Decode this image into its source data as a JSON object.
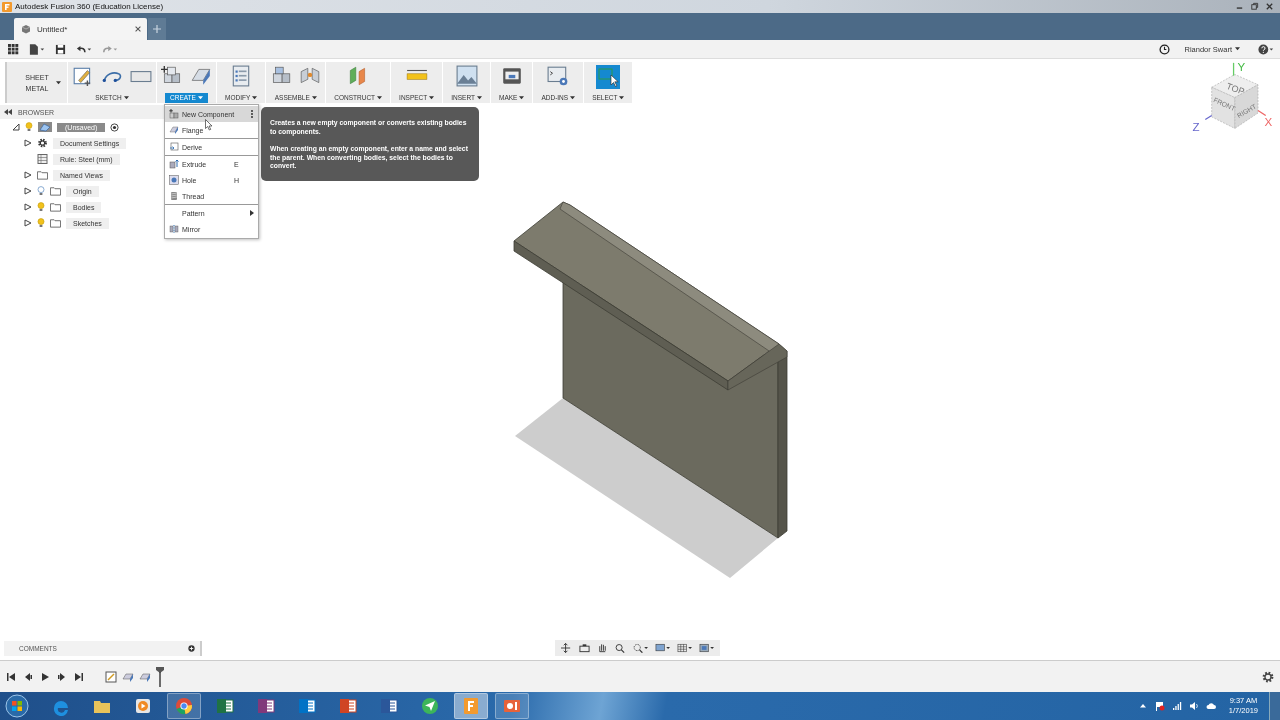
{
  "title_bar": {
    "title": "Autodesk Fusion 360 (Education License)"
  },
  "document_tabs": [
    {
      "label": "Untitled*",
      "selected": true
    }
  ],
  "user": {
    "name": "Riandor Swart"
  },
  "ribbon": {
    "workspace": "SHEET METAL",
    "groups": [
      {
        "label": "SKETCH",
        "selected": false
      },
      {
        "label": "CREATE",
        "selected": true
      },
      {
        "label": "MODIFY",
        "selected": false
      },
      {
        "label": "ASSEMBLE",
        "selected": false
      },
      {
        "label": "CONSTRUCT",
        "selected": false
      },
      {
        "label": "INSPECT",
        "selected": false
      },
      {
        "label": "INSERT",
        "selected": false
      },
      {
        "label": "MAKE",
        "selected": false
      },
      {
        "label": "ADD-INS",
        "selected": false
      },
      {
        "label": "SELECT",
        "selected": false
      }
    ]
  },
  "create_menu": {
    "items": [
      {
        "kind": "command",
        "label": "New Component",
        "selected": true,
        "divider_after": false
      },
      {
        "kind": "command",
        "label": "Flange",
        "selected": false,
        "divider_after": true
      },
      {
        "kind": "command",
        "label": "Derive",
        "selected": false,
        "divider_after": true
      },
      {
        "kind": "command",
        "label": "Extrude",
        "shortcut": "E",
        "selected": false,
        "divider_after": false
      },
      {
        "kind": "command",
        "label": "Hole",
        "shortcut": "H",
        "selected": false,
        "divider_after": false
      },
      {
        "kind": "command",
        "label": "Thread",
        "selected": false,
        "divider_after": true
      },
      {
        "kind": "submenu",
        "label": "Pattern",
        "selected": false,
        "divider_after": false
      },
      {
        "kind": "command",
        "label": "Mirror",
        "selected": false,
        "divider_after": false
      }
    ]
  },
  "tooltip": {
    "paragraphs": [
      "Creates a new empty component or converts existing bodies to components.",
      "When creating an empty component, enter a name and select the parent. When converting bodies, select the bodies to convert."
    ]
  },
  "browser": {
    "title": "BROWSER",
    "root": {
      "label": "(Unsaved)",
      "expanded": true,
      "visible": true,
      "children": [
        {
          "kind": "settings",
          "label": "Document Settings",
          "expanded": false
        },
        {
          "kind": "rule",
          "label": "Rule: Steel (mm)"
        },
        {
          "kind": "folder",
          "label": "Named Views",
          "expanded": false
        },
        {
          "kind": "folder",
          "label": "Origin",
          "expanded": false,
          "visible": false
        },
        {
          "kind": "folder",
          "label": "Bodies",
          "expanded": false,
          "visible": true
        },
        {
          "kind": "folder",
          "label": "Sketches",
          "expanded": false,
          "visible": true
        }
      ]
    }
  },
  "view_cube": {
    "faces": [
      "TOP",
      "FRONT",
      "RIGHT"
    ],
    "axes": [
      "X",
      "Y",
      "Z"
    ]
  },
  "comments": {
    "label": "COMMENTS"
  },
  "taskbar": {
    "apps": [
      {
        "kind": "ie",
        "running": false,
        "selected": false
      },
      {
        "kind": "explorer",
        "running": false,
        "selected": false
      },
      {
        "kind": "media",
        "running": false,
        "selected": false
      },
      {
        "kind": "chrome",
        "running": true,
        "selected": false
      },
      {
        "kind": "excel",
        "running": false,
        "selected": false
      },
      {
        "kind": "onenote",
        "running": false,
        "selected": false
      },
      {
        "kind": "outlook",
        "running": false,
        "selected": false
      },
      {
        "kind": "powerpoint",
        "running": false,
        "selected": false
      },
      {
        "kind": "word",
        "running": false,
        "selected": false
      },
      {
        "kind": "send",
        "running": false,
        "selected": false
      },
      {
        "kind": "fusion",
        "running": true,
        "selected": true
      },
      {
        "kind": "recorder",
        "running": true,
        "selected": false
      }
    ],
    "clock": {
      "time": "9:37 AM",
      "date": "1/7/2019"
    }
  }
}
